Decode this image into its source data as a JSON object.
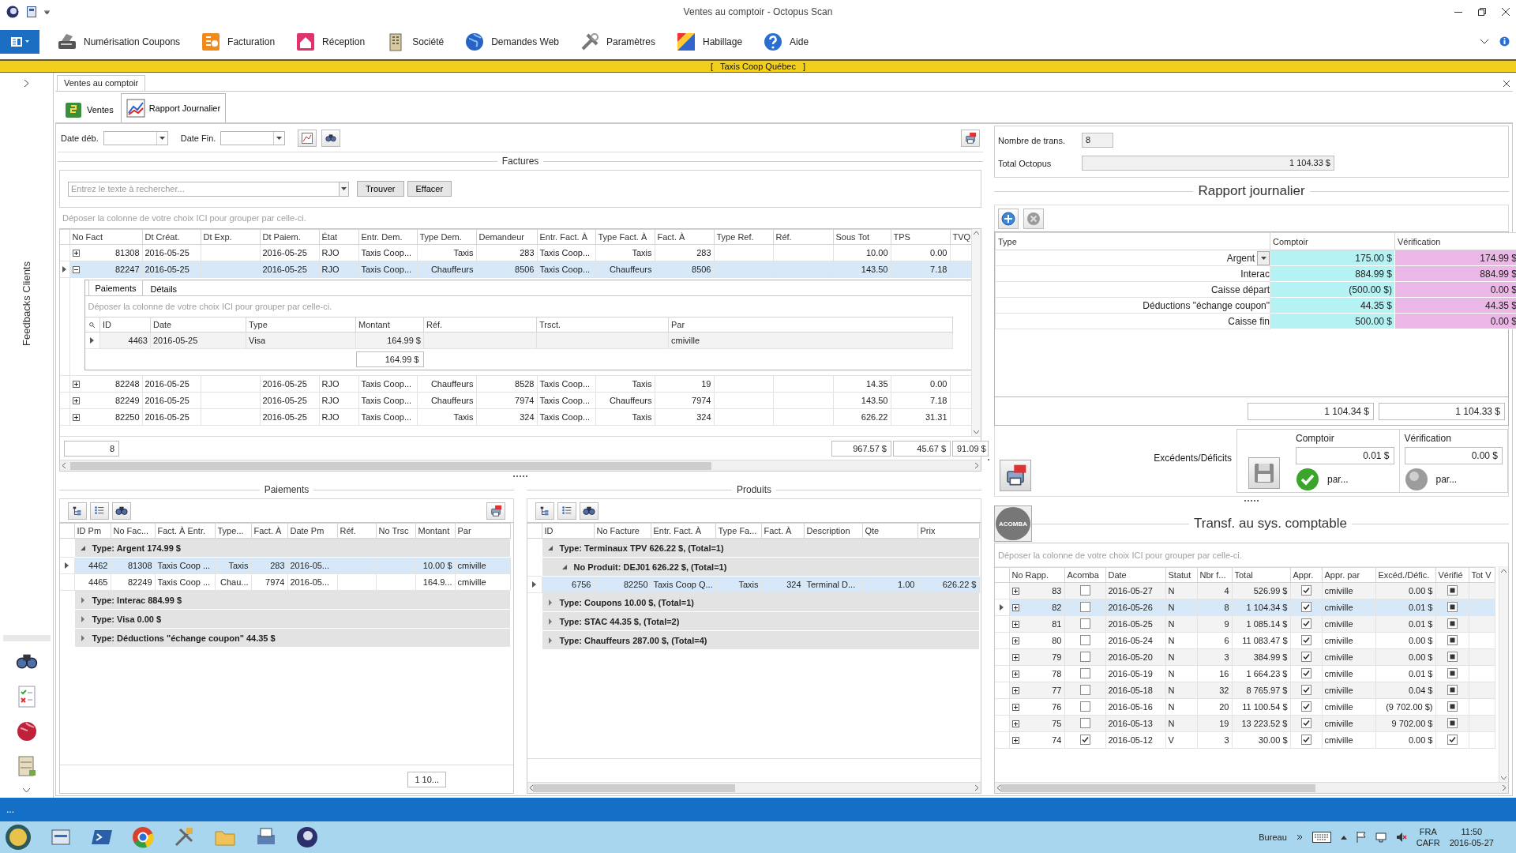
{
  "window": {
    "title": "Ventes au comptoir - Octopus Scan"
  },
  "ribbon": {
    "items": [
      {
        "label": "Numérisation Coupons"
      },
      {
        "label": "Facturation"
      },
      {
        "label": "Réception"
      },
      {
        "label": "Société"
      },
      {
        "label": "Demandes Web"
      },
      {
        "label": "Paramètres"
      },
      {
        "label": "Habillage"
      },
      {
        "label": "Aide"
      }
    ]
  },
  "company_bar": {
    "text": "[   Taxis Coop Québec   ]"
  },
  "sidebar": {
    "label": "Feedbacks Clients"
  },
  "document_tab": {
    "label": "Ventes au comptoir"
  },
  "tabs": [
    {
      "label": "Ventes",
      "selected": false
    },
    {
      "label": "Rapport Journalier",
      "selected": true
    }
  ],
  "filters": [
    {
      "label": "Date déb."
    },
    {
      "label": "Date Fin."
    }
  ],
  "factures": {
    "title": "Factures",
    "search": {
      "placeholder": "Entrez le texte à rechercher...",
      "buttons": [
        "Trouver",
        "Effacer"
      ]
    },
    "group_hint": "Déposer la colonne de votre choix ICI pour grouper par celle-ci.",
    "columns": [
      "No Fact",
      "Dt Créat.",
      "Dt Exp.",
      "Dt Paiem.",
      "État",
      "Entr. Dem.",
      "Type Dem.",
      "Demandeur",
      "Entr. Fact. À",
      "Type Fact. À",
      "Fact. À",
      "Type Ref.",
      "Réf.",
      "Sous Tot",
      "TPS",
      "TVQ"
    ],
    "rows": [
      {
        "selected": false,
        "expanded": false,
        "cells": [
          "81308",
          "2016-05-25",
          null,
          "2016-05-25",
          "RJO",
          "Taxis Coop...",
          "Taxis",
          "283",
          "Taxis Coop...",
          "Taxis",
          "283",
          null,
          null,
          "10.00",
          "0.00",
          null
        ]
      },
      {
        "selected": true,
        "expanded": true,
        "cells": [
          "82247",
          "2016-05-25",
          null,
          "2016-05-25",
          "RJO",
          "Taxis Coop...",
          "Chauffeurs",
          "8506",
          "Taxis Coop...",
          "Chauffeurs",
          "8506",
          null,
          null,
          "143.50",
          "7.18",
          null
        ],
        "detail": {
          "tabs": [
            {
              "label": "Paiements",
              "selected": true
            },
            {
              "label": "Détails",
              "selected": false
            }
          ],
          "group_hint": "Déposer la colonne de votre choix ICI pour grouper par celle-ci.",
          "columns": [
            "ID",
            "Date",
            "Type",
            "Montant",
            "Réf.",
            "Trsct.",
            "Par"
          ],
          "rows": [
            {
              "selected": false,
              "cells": [
                "4463",
                "2016-05-25",
                "Visa",
                "164.99 $",
                null,
                null,
                "cmiville"
              ]
            }
          ],
          "total": "164.99 $"
        }
      },
      {
        "selected": false,
        "expanded": false,
        "cells": [
          "82248",
          "2016-05-25",
          null,
          "2016-05-25",
          "RJO",
          "Taxis Coop...",
          "Chauffeurs",
          "8528",
          "Taxis Coop...",
          "Taxis",
          "19",
          null,
          null,
          "14.35",
          "0.00",
          null
        ]
      },
      {
        "selected": false,
        "expanded": false,
        "cells": [
          "82249",
          "2016-05-25",
          null,
          "2016-05-25",
          "RJO",
          "Taxis Coop...",
          "Chauffeurs",
          "7974",
          "Taxis Coop...",
          "Chauffeurs",
          "7974",
          null,
          null,
          "143.50",
          "7.18",
          null
        ]
      },
      {
        "selected": false,
        "expanded": false,
        "cells": [
          "82250",
          "2016-05-25",
          null,
          "2016-05-25",
          "RJO",
          "Taxis Coop...",
          "Taxis",
          "324",
          "Taxis Coop...",
          "Taxis",
          "324",
          null,
          null,
          "626.22",
          "31.31",
          null
        ]
      }
    ],
    "footer": {
      "count": "8",
      "sous_tot": "967.57 $",
      "tps": "45.67 $",
      "tvq": "91.09 $"
    }
  },
  "paiements": {
    "title": "Paiements",
    "columns": [
      "ID Pm",
      "No Fac...",
      "Fact. À Entr.",
      "Type...",
      "Fact. À",
      "Date Pm",
      "Réf.",
      "No Trsc",
      "Montant",
      "Par"
    ],
    "items": [
      {
        "kind": "group",
        "label": "Type: Argent 174.99 $",
        "expanded": true,
        "children": [
          {
            "kind": "row",
            "selected": true,
            "cells": [
              "4462",
              "81308",
              "Taxis Coop ...",
              "Taxis",
              "283",
              "2016-05...",
              null,
              null,
              "10.00 $",
              "cmiville"
            ]
          },
          {
            "kind": "row",
            "selected": false,
            "cells": [
              "4465",
              "82249",
              "Taxis Coop ...",
              "Chau...",
              "7974",
              "2016-05...",
              null,
              null,
              "164.9...",
              "cmiville"
            ]
          }
        ]
      },
      {
        "kind": "group",
        "label": "Type: Interac 884.99 $",
        "expanded": false
      },
      {
        "kind": "group",
        "label": "Type: Visa 0.00 $",
        "expanded": false
      },
      {
        "kind": "group",
        "label": "Type: Déductions \"échange coupon\" 44.35 $",
        "expanded": false
      }
    ],
    "pager": "1 10..."
  },
  "produits": {
    "title": "Produits",
    "columns": [
      "ID",
      "No Facture",
      "Entr. Fact. À",
      "Type Fa...",
      "Fact. À",
      "Description",
      "Qte",
      "Prix"
    ],
    "items": [
      {
        "kind": "group",
        "label": "Type: Terminaux TPV 626.22 $, (Total=1)",
        "expanded": true,
        "children": [
          {
            "kind": "group",
            "label": "No Produit: DEJ01 626.22 $, (Total=1)",
            "expanded": true,
            "children": [
              {
                "kind": "row",
                "selected": true,
                "cells": [
                  "6756",
                  "82250",
                  "Taxis Coop Q...",
                  "Taxis",
                  "324",
                  "Terminal D...",
                  "1.00",
                  "626.22 $"
                ]
              }
            ]
          }
        ]
      },
      {
        "kind": "group",
        "label": "Type: Coupons 10.00 $, (Total=1)",
        "expanded": false
      },
      {
        "kind": "group",
        "label": "Type: STAC 44.35 $, (Total=2)",
        "expanded": false
      },
      {
        "kind": "group",
        "label": "Type: Chauffeurs 287.00 $, (Total=4)",
        "expanded": false
      }
    ]
  },
  "summary": {
    "fields": [
      {
        "label": "Nombre de trans.",
        "value": "8"
      },
      {
        "label": "Total Octopus",
        "value": "1 104.33 $"
      }
    ]
  },
  "rapport": {
    "title": "Rapport journalier",
    "columns": [
      "Type",
      "Comptoir",
      "Vérification"
    ],
    "rows": [
      {
        "type": "Argent",
        "comptoir": "175.00 $",
        "verification": "174.99 $",
        "editing": true
      },
      {
        "type": "Interac",
        "comptoir": "884.99 $",
        "verification": "884.99 $",
        "editing": false
      },
      {
        "type": "Caisse départ",
        "comptoir": "(500.00 $)",
        "verification": "0.00 $",
        "editing": false
      },
      {
        "type": "Déductions \"échange coupon\"",
        "comptoir": "44.35 $",
        "verification": "44.35 $",
        "editing": false
      },
      {
        "type": "Caisse fin",
        "comptoir": "500.00 $",
        "verification": "0.00 $",
        "editing": false
      }
    ],
    "totals": [
      "1 104.34 $",
      "1 104.33 $"
    ]
  },
  "excedents": {
    "label": "Excédents/Déficits",
    "columns": [
      {
        "label": "Comptoir",
        "value": "0.01 $",
        "approved": true,
        "by": "par..."
      },
      {
        "label": "Vérification",
        "value": "0.00 $",
        "approved": false,
        "by": "par..."
      }
    ]
  },
  "transfert": {
    "title": "Transf. au sys. comptable",
    "logo": "ACOMBA",
    "group_hint": "Déposer la colonne de votre choix ICI pour grouper par celle-ci.",
    "columns": [
      "No Rapp.",
      "Acomba",
      "Date",
      "Statut",
      "Nbr f...",
      "Total",
      "Appr.",
      "Appr. par",
      "Excéd./Défic.",
      "Vérifié",
      "Tot V"
    ],
    "rows": [
      {
        "no": "83",
        "acomba": false,
        "date": "2016-05-27",
        "statut": "N",
        "nbr": "4",
        "total": "526.99 $",
        "appr": true,
        "appr_par": "cmiville",
        "exced": "0.00 $",
        "verifie": false,
        "selected": false
      },
      {
        "no": "82",
        "acomba": false,
        "date": "2016-05-26",
        "statut": "N",
        "nbr": "8",
        "total": "1 104.34 $",
        "appr": true,
        "appr_par": "cmiville",
        "exced": "0.01 $",
        "verifie": false,
        "selected": true
      },
      {
        "no": "81",
        "acomba": false,
        "date": "2016-05-25",
        "statut": "N",
        "nbr": "9",
        "total": "1 085.14 $",
        "appr": true,
        "appr_par": "cmiville",
        "exced": "0.01 $",
        "verifie": false,
        "selected": false
      },
      {
        "no": "80",
        "acomba": false,
        "date": "2016-05-24",
        "statut": "N",
        "nbr": "6",
        "total": "11 083.47 $",
        "appr": true,
        "appr_par": "cmiville",
        "exced": "0.00 $",
        "verifie": false,
        "selected": false
      },
      {
        "no": "79",
        "acomba": false,
        "date": "2016-05-20",
        "statut": "N",
        "nbr": "3",
        "total": "384.99 $",
        "appr": true,
        "appr_par": "cmiville",
        "exced": "0.00 $",
        "verifie": false,
        "selected": false
      },
      {
        "no": "78",
        "acomba": false,
        "date": "2016-05-19",
        "statut": "N",
        "nbr": "16",
        "total": "1 664.23 $",
        "appr": true,
        "appr_par": "cmiville",
        "exced": "0.01 $",
        "verifie": false,
        "selected": false
      },
      {
        "no": "77",
        "acomba": false,
        "date": "2016-05-18",
        "statut": "N",
        "nbr": "32",
        "total": "8 765.97 $",
        "appr": true,
        "appr_par": "cmiville",
        "exced": "0.04 $",
        "verifie": false,
        "selected": false
      },
      {
        "no": "76",
        "acomba": false,
        "date": "2016-05-16",
        "statut": "N",
        "nbr": "20",
        "total": "11 100.54 $",
        "appr": true,
        "appr_par": "cmiville",
        "exced": "(9 702.00 $)",
        "verifie": false,
        "selected": false
      },
      {
        "no": "75",
        "acomba": false,
        "date": "2016-05-13",
        "statut": "N",
        "nbr": "19",
        "total": "13 223.52 $",
        "appr": true,
        "appr_par": "cmiville",
        "exced": "9 702.00 $",
        "verifie": false,
        "selected": false
      },
      {
        "no": "74",
        "acomba": true,
        "date": "2016-05-12",
        "statut": "V",
        "nbr": "3",
        "total": "30.00 $",
        "appr": true,
        "appr_par": "cmiville",
        "exced": "0.00 $",
        "verifie": true,
        "selected": false
      }
    ]
  },
  "status_bar": {
    "text": "..."
  },
  "taskbar": {
    "toolbar": "Bureau",
    "language": "FRA",
    "layout": "CAFR",
    "time": "11:50",
    "date": "2016-05-27"
  }
}
